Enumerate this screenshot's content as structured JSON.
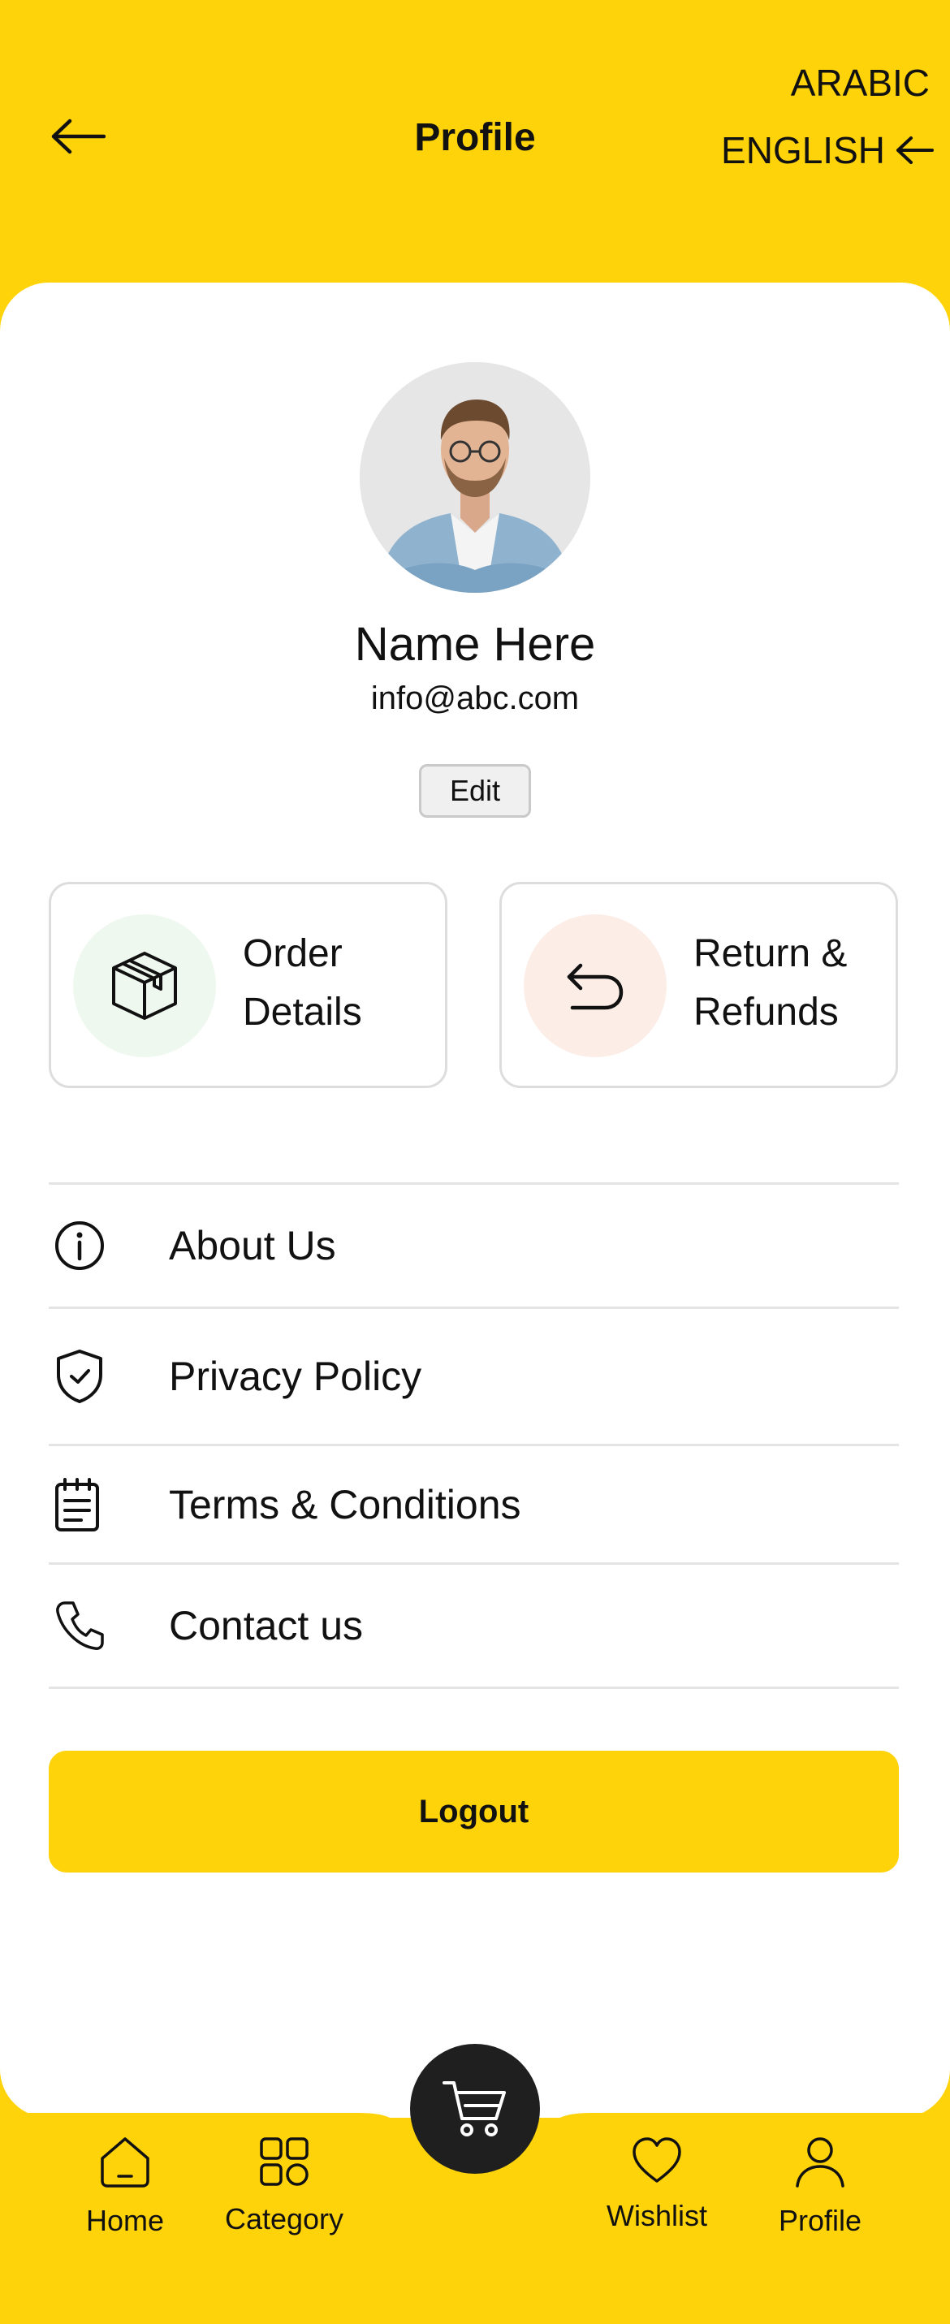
{
  "header": {
    "title": "Profile",
    "lang_arabic": "ARABIC",
    "lang_english": "ENGLISH"
  },
  "profile": {
    "name": "Name Here",
    "email": "info@abc.com",
    "edit_label": "Edit"
  },
  "tiles": [
    {
      "label": "Order Details",
      "icon": "package-icon"
    },
    {
      "label": "Return & Refunds",
      "icon": "return-arrow-icon"
    }
  ],
  "menu": [
    {
      "label": "About Us",
      "icon": "info-icon"
    },
    {
      "label": "Privacy Policy",
      "icon": "shield-check-icon"
    },
    {
      "label": "Terms & Conditions",
      "icon": "notepad-icon"
    },
    {
      "label": "Contact us",
      "icon": "phone-icon"
    }
  ],
  "logout_label": "Logout",
  "nav": [
    {
      "label": "Home",
      "icon": "home-icon"
    },
    {
      "label": "Category",
      "icon": "category-icon"
    },
    {
      "label": "Wishlist",
      "icon": "heart-icon"
    },
    {
      "label": "Profile",
      "icon": "user-icon"
    }
  ],
  "colors": {
    "brand_yellow": "#FFD30A",
    "cart_dark": "#1F1F1F",
    "order_tint": "#EEF8EF",
    "return_tint": "#FCEDE6"
  }
}
